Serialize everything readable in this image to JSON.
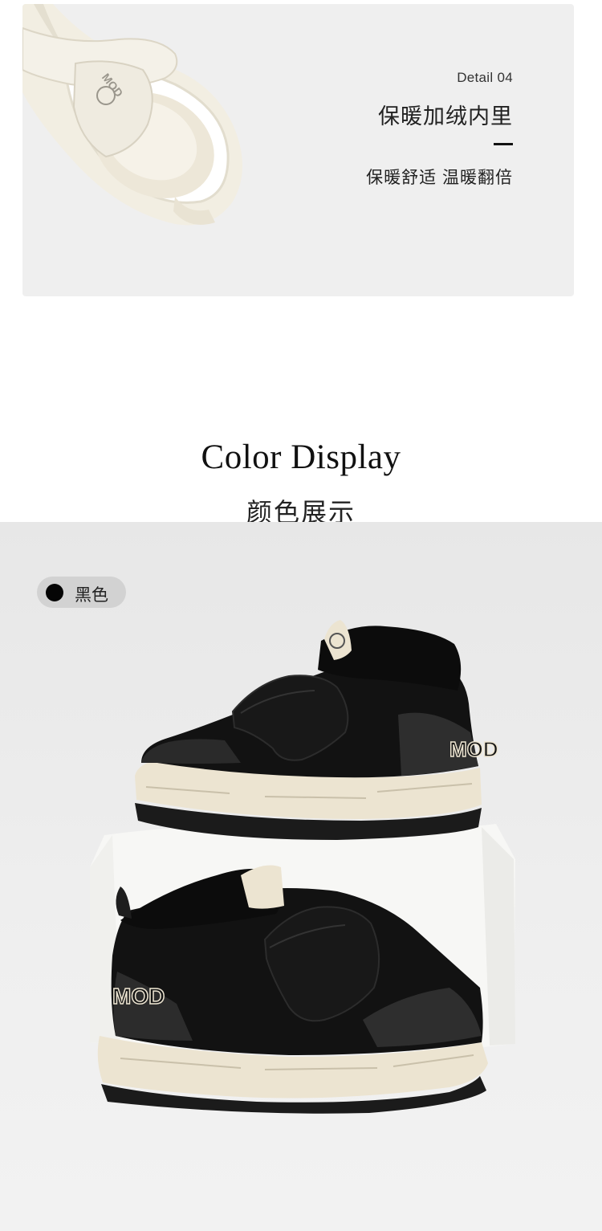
{
  "detail": {
    "label": "Detail 04",
    "title": "保暖加绒内里",
    "desc": "保暖舒适 温暖翻倍",
    "tag_text": "MOD"
  },
  "color_section": {
    "title_en": "Color Display",
    "title_zh": "颜色展示"
  },
  "swatch": {
    "name": "黑色",
    "color": "#050505"
  },
  "product": {
    "shoe_text": "MOD",
    "colors": {
      "upper": "#121212",
      "sole": "#ece4d1",
      "outsole": "#1b1b1b",
      "pedestal": "#f7f7f5",
      "lining": "#f3efe4"
    }
  }
}
